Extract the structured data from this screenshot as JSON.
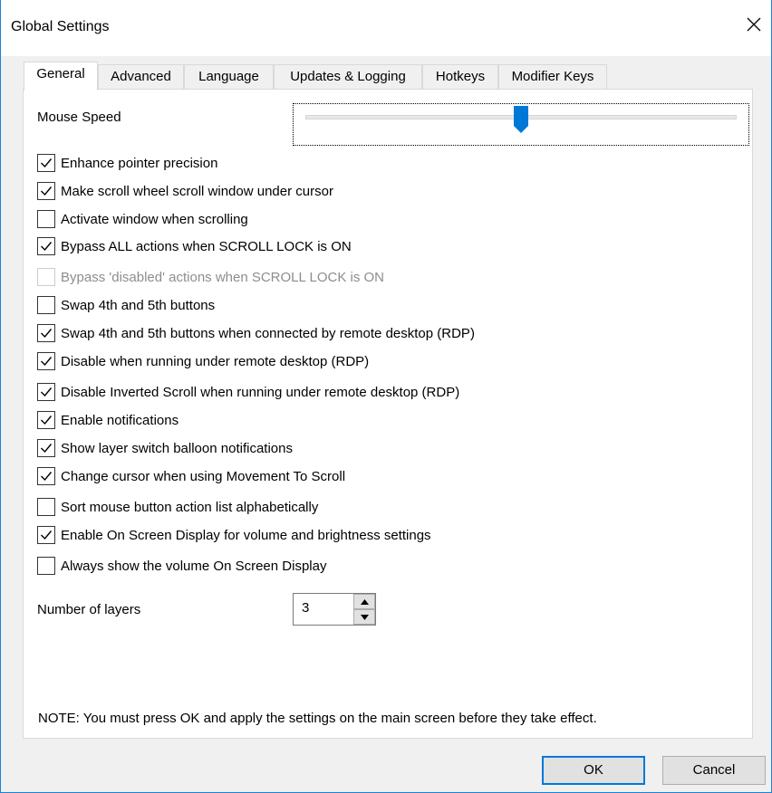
{
  "window": {
    "title": "Global Settings"
  },
  "tabs": [
    {
      "label": "General",
      "active": true
    },
    {
      "label": "Advanced",
      "active": false
    },
    {
      "label": "Language",
      "active": false
    },
    {
      "label": "Updates & Logging",
      "active": false
    },
    {
      "label": "Hotkeys",
      "active": false
    },
    {
      "label": "Modifier Keys",
      "active": false
    }
  ],
  "general": {
    "mouse_speed_label": "Mouse Speed",
    "mouse_speed_level": 0.5,
    "checkboxes": [
      {
        "label": "Enhance pointer precision",
        "checked": true,
        "disabled": false
      },
      {
        "label": "Make scroll wheel scroll window under cursor",
        "checked": true,
        "disabled": false
      },
      {
        "label": "Activate window when scrolling",
        "checked": false,
        "disabled": false
      },
      {
        "label": "Bypass ALL actions when SCROLL LOCK is ON",
        "checked": true,
        "disabled": false
      },
      {
        "label": "Bypass 'disabled' actions when SCROLL LOCK is ON",
        "checked": false,
        "disabled": true
      },
      {
        "label": "Swap 4th and 5th buttons",
        "checked": false,
        "disabled": false
      },
      {
        "label": "Swap 4th and 5th buttons when connected by remote desktop (RDP)",
        "checked": true,
        "disabled": false
      },
      {
        "label": "Disable when running under remote desktop (RDP)",
        "checked": true,
        "disabled": false
      },
      {
        "label": "Disable Inverted Scroll when running under remote desktop (RDP)",
        "checked": true,
        "disabled": false
      },
      {
        "label": "Enable notifications",
        "checked": true,
        "disabled": false
      },
      {
        "label": "Show layer switch balloon notifications",
        "checked": true,
        "disabled": false
      },
      {
        "label": "Change cursor when using Movement To Scroll",
        "checked": true,
        "disabled": false
      },
      {
        "label": "Sort mouse button action list alphabetically",
        "checked": false,
        "disabled": false
      },
      {
        "label": "Enable On Screen Display for volume and brightness settings",
        "checked": true,
        "disabled": false
      },
      {
        "label": "Always show the volume On Screen Display",
        "checked": false,
        "disabled": false
      }
    ],
    "layers_label": "Number of layers",
    "layers_value": "3",
    "note": "NOTE: You must press OK and apply the settings on the main screen before they take effect."
  },
  "buttons": {
    "ok": "OK",
    "cancel": "Cancel"
  },
  "colors": {
    "accent": "#0078d7",
    "window_border": "#1883d7"
  }
}
